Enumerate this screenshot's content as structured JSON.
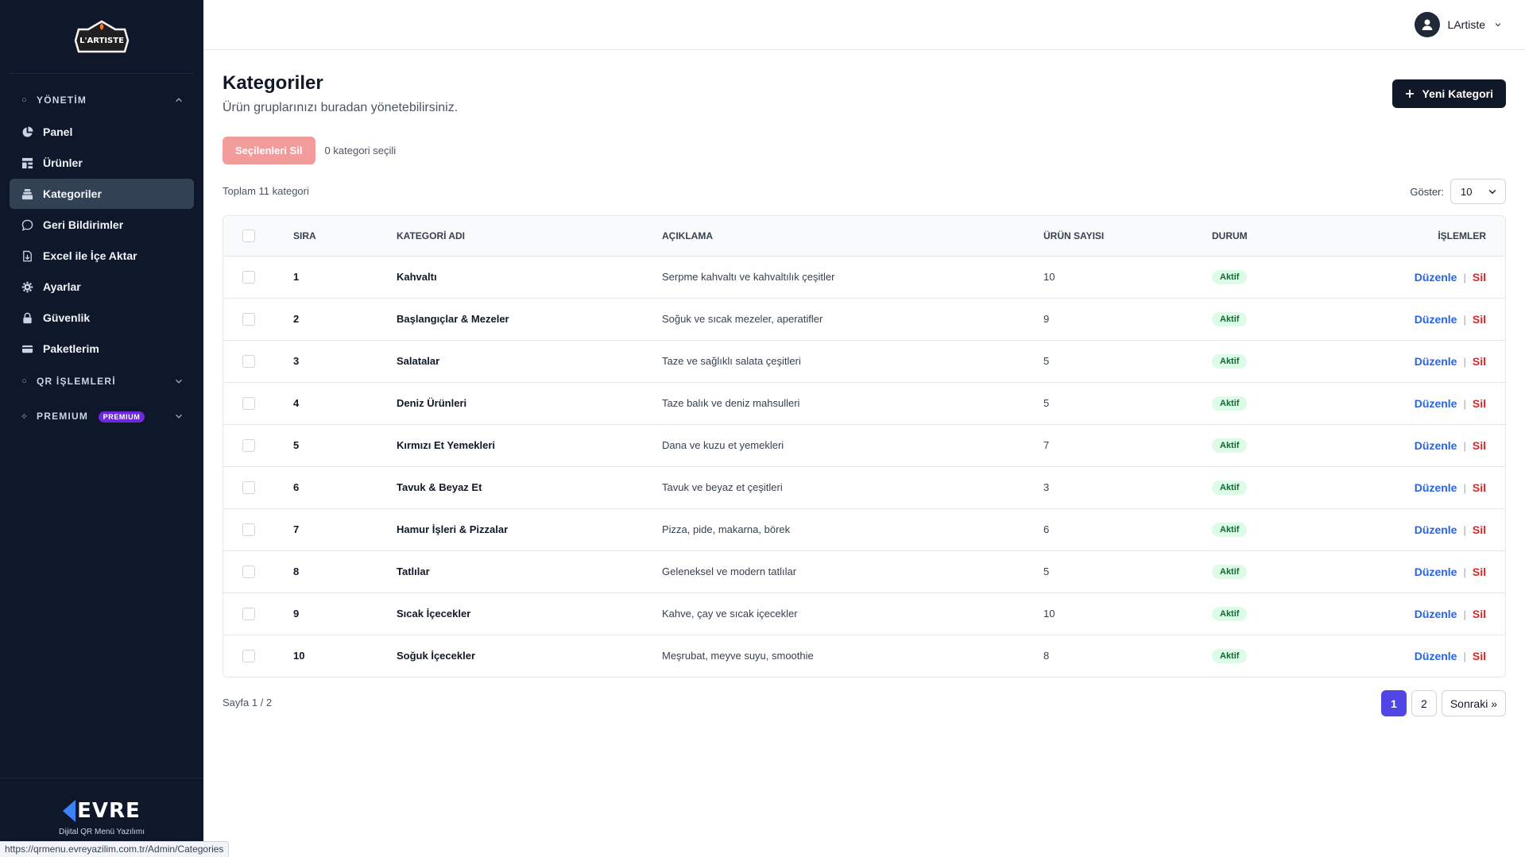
{
  "brand": {
    "logo_text": "L'ARTISTE"
  },
  "sidebar": {
    "sections": {
      "yonetim": "YÖNETİM",
      "qr": "QR İŞLEMLERİ",
      "premium": "PREMIUM",
      "premium_badge": "PREMIUM"
    },
    "items": [
      {
        "label": "Panel",
        "icon": "pie-chart-icon"
      },
      {
        "label": "Ürünler",
        "icon": "grid-icon"
      },
      {
        "label": "Kategoriler",
        "icon": "layers-icon"
      },
      {
        "label": "Geri Bildirimler",
        "icon": "chat-icon"
      },
      {
        "label": "Excel ile İçe Aktar",
        "icon": "file-import-icon"
      },
      {
        "label": "Ayarlar",
        "icon": "gear-icon"
      },
      {
        "label": "Güvenlik",
        "icon": "lock-icon"
      },
      {
        "label": "Paketlerim",
        "icon": "card-icon"
      }
    ],
    "active_index": 2,
    "footer": {
      "logo_text": "EVRE",
      "tagline": "Dijital QR Menü Yazılımı"
    }
  },
  "header": {
    "user_name": "LArtiste"
  },
  "page": {
    "title": "Kategoriler",
    "subtitle": "Ürün gruplarınızı buradan yönetebilirsiniz.",
    "new_button": "Yeni Kategori",
    "bulk_delete": "Seçilenleri Sil",
    "selected_count": "0 kategori seçili",
    "total": "Toplam 11 kategori",
    "show_label": "Göster:",
    "show_value": "10"
  },
  "table": {
    "headers": {
      "sira": "SIRA",
      "name": "KATEGORİ ADI",
      "desc": "AÇIKLAMA",
      "count": "ÜRÜN SAYISI",
      "status": "DURUM",
      "actions": "İŞLEMLER"
    },
    "rows": [
      {
        "sira": "1",
        "name": "Kahvaltı",
        "desc": "Serpme kahvaltı ve kahvaltılık çeşitler",
        "count": "10",
        "status": "Aktif"
      },
      {
        "sira": "2",
        "name": "Başlangıçlar & Mezeler",
        "desc": "Soğuk ve sıcak mezeler, aperatifler",
        "count": "9",
        "status": "Aktif"
      },
      {
        "sira": "3",
        "name": "Salatalar",
        "desc": "Taze ve sağlıklı salata çeşitleri",
        "count": "5",
        "status": "Aktif"
      },
      {
        "sira": "4",
        "name": "Deniz Ürünleri",
        "desc": "Taze balık ve deniz mahsulleri",
        "count": "5",
        "status": "Aktif"
      },
      {
        "sira": "5",
        "name": "Kırmızı Et Yemekleri",
        "desc": "Dana ve kuzu et yemekleri",
        "count": "7",
        "status": "Aktif"
      },
      {
        "sira": "6",
        "name": "Tavuk & Beyaz Et",
        "desc": "Tavuk ve beyaz et çeşitleri",
        "count": "3",
        "status": "Aktif"
      },
      {
        "sira": "7",
        "name": "Hamur İşleri & Pizzalar",
        "desc": "Pizza, pide, makarna, börek",
        "count": "6",
        "status": "Aktif"
      },
      {
        "sira": "8",
        "name": "Tatlılar",
        "desc": "Geleneksel ve modern tatlılar",
        "count": "5",
        "status": "Aktif"
      },
      {
        "sira": "9",
        "name": "Sıcak İçecekler",
        "desc": "Kahve, çay ve sıcak içecekler",
        "count": "10",
        "status": "Aktif"
      },
      {
        "sira": "10",
        "name": "Soğuk İçecekler",
        "desc": "Meşrubat, meyve suyu, smoothie",
        "count": "8",
        "status": "Aktif"
      }
    ],
    "edit_label": "Düzenle",
    "delete_label": "Sil",
    "separator": "|"
  },
  "pagination": {
    "info": "Sayfa 1 / 2",
    "pages": [
      "1",
      "2"
    ],
    "current": "1",
    "next": "Sonraki »"
  },
  "status_bar": {
    "url": "https://qrmenu.evreyazilim.com.tr/Admin/Categories"
  }
}
